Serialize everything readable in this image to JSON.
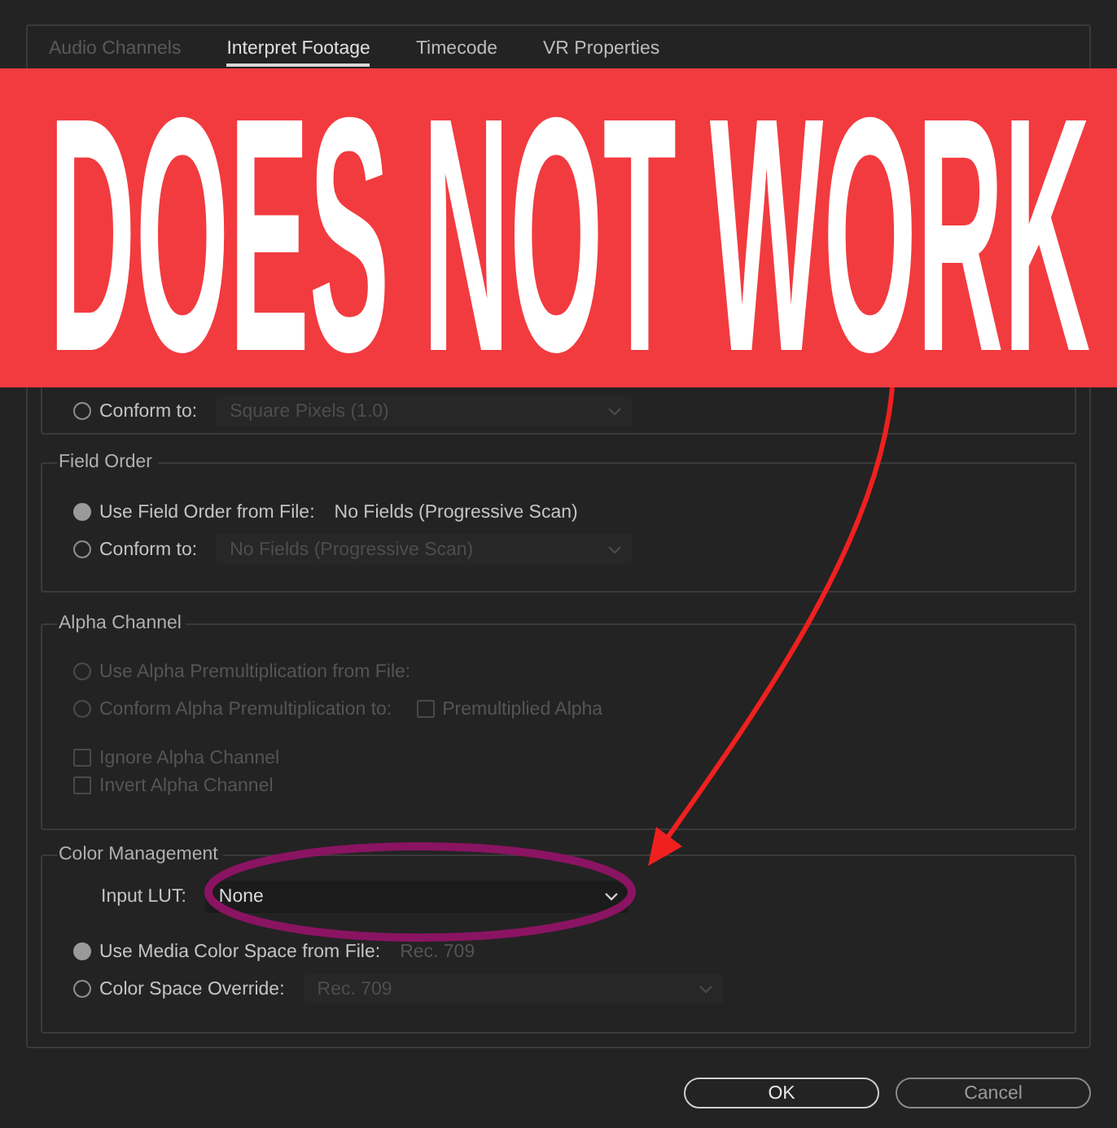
{
  "tabs": [
    {
      "label": "Audio Channels",
      "selected": false,
      "disabled": true
    },
    {
      "label": "Interpret Footage",
      "selected": true,
      "disabled": false
    },
    {
      "label": "Timecode",
      "selected": false,
      "disabled": false
    },
    {
      "label": "VR Properties",
      "selected": false,
      "disabled": false
    }
  ],
  "sections": [
    {
      "rows": [
        {
          "kind": "radio",
          "label": "Conform to:",
          "selected": false,
          "disabled": false,
          "dropdown": {
            "value": "Square Pixels (1.0)",
            "disabled": true
          }
        }
      ]
    },
    {
      "title": "Field Order",
      "rows": [
        {
          "kind": "radio",
          "label": "Use Field Order from File:",
          "selected": true,
          "disabled": false,
          "value": {
            "text": "No Fields (Progressive Scan)",
            "disabled": false
          }
        },
        {
          "kind": "radio",
          "label": "Conform to:",
          "selected": false,
          "disabled": false,
          "dropdown": {
            "value": "No Fields (Progressive Scan)",
            "disabled": true
          }
        }
      ]
    },
    {
      "title": "Alpha Channel",
      "rows": [
        {
          "kind": "radio",
          "label": "Use Alpha Premultiplication from File:",
          "selected": false,
          "disabled": true
        },
        {
          "kind": "radio",
          "label": "Conform Alpha Premultiplication to:",
          "selected": false,
          "disabled": true,
          "checkbox": {
            "label": "Premultiplied Alpha",
            "checked": false,
            "disabled": true
          }
        }
      ],
      "checkboxes": [
        {
          "label": "Ignore Alpha Channel",
          "checked": false,
          "disabled": true
        },
        {
          "label": "Invert Alpha Channel",
          "checked": false,
          "disabled": true
        }
      ]
    },
    {
      "title": "Color Management",
      "rows": [
        {
          "kind": "select",
          "label": "Input LUT:",
          "dropdown": {
            "value": "None",
            "disabled": false
          }
        },
        {
          "kind": "radio",
          "label": "Use Media Color Space from File:",
          "selected": true,
          "disabled": false,
          "value": {
            "text": "Rec. 709",
            "disabled": true
          }
        },
        {
          "kind": "radio",
          "label": "Color Space Override:",
          "selected": false,
          "disabled": false,
          "dropdown": {
            "value": "Rec. 709",
            "disabled": true
          }
        }
      ]
    }
  ],
  "buttons": [
    {
      "label": "OK",
      "kind": "primary"
    },
    {
      "label": "Cancel",
      "kind": "secondary"
    }
  ],
  "banner": {
    "text": "DOES NOT WORK"
  }
}
